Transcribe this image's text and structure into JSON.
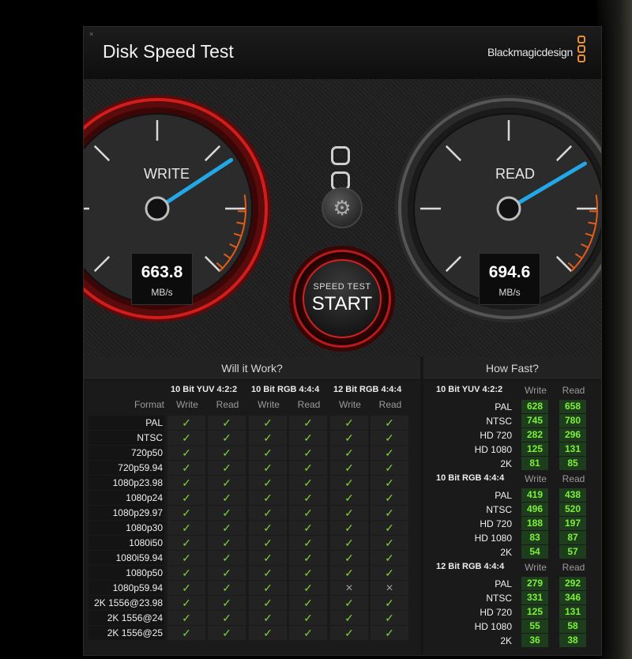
{
  "window": {
    "title": "Disk Speed Test",
    "brand": "Blackmagicdesign",
    "close_glyph": "×"
  },
  "gauges": {
    "write": {
      "label": "WRITE",
      "value": "663.8",
      "unit": "MB/s",
      "needle_fraction": 0.83,
      "accent": "#d21d1d"
    },
    "read": {
      "label": "READ",
      "value": "694.6",
      "unit": "MB/s",
      "needle_fraction": 0.87,
      "accent": "#555555"
    },
    "needle_color": "#22a8e8",
    "redline_color": "#e25c1a"
  },
  "start_button": {
    "small": "SPEED TEST",
    "big": "START"
  },
  "settings_icon": "gear-icon",
  "will_it_work": {
    "title": "Will it Work?",
    "format_header": "Format",
    "groups": [
      "10 Bit YUV 4:2:2",
      "10 Bit RGB 4:4:4",
      "12 Bit RGB 4:4:4"
    ],
    "sub_headers": [
      "Write",
      "Read",
      "Write",
      "Read",
      "Write",
      "Read"
    ],
    "check_glyph": "✓",
    "cross_glyph": "✕",
    "rows": [
      {
        "format": "PAL",
        "results": [
          1,
          1,
          1,
          1,
          1,
          1
        ]
      },
      {
        "format": "NTSC",
        "results": [
          1,
          1,
          1,
          1,
          1,
          1
        ]
      },
      {
        "format": "720p50",
        "results": [
          1,
          1,
          1,
          1,
          1,
          1
        ]
      },
      {
        "format": "720p59.94",
        "results": [
          1,
          1,
          1,
          1,
          1,
          1
        ]
      },
      {
        "format": "1080p23.98",
        "results": [
          1,
          1,
          1,
          1,
          1,
          1
        ]
      },
      {
        "format": "1080p24",
        "results": [
          1,
          1,
          1,
          1,
          1,
          1
        ]
      },
      {
        "format": "1080p29.97",
        "results": [
          1,
          1,
          1,
          1,
          1,
          1
        ]
      },
      {
        "format": "1080p30",
        "results": [
          1,
          1,
          1,
          1,
          1,
          1
        ]
      },
      {
        "format": "1080i50",
        "results": [
          1,
          1,
          1,
          1,
          1,
          1
        ]
      },
      {
        "format": "1080i59.94",
        "results": [
          1,
          1,
          1,
          1,
          1,
          1
        ]
      },
      {
        "format": "1080p50",
        "results": [
          1,
          1,
          1,
          1,
          1,
          1
        ]
      },
      {
        "format": "1080p59.94",
        "results": [
          1,
          1,
          1,
          1,
          0,
          0
        ]
      },
      {
        "format": "2K 1556@23.98",
        "results": [
          1,
          1,
          1,
          1,
          1,
          1
        ]
      },
      {
        "format": "2K 1556@24",
        "results": [
          1,
          1,
          1,
          1,
          1,
          1
        ]
      },
      {
        "format": "2K 1556@25",
        "results": [
          1,
          1,
          1,
          1,
          1,
          1
        ]
      }
    ]
  },
  "how_fast": {
    "title": "How Fast?",
    "write_header": "Write",
    "read_header": "Read",
    "groups": [
      {
        "name": "10 Bit YUV 4:2:2",
        "rows": [
          {
            "label": "PAL",
            "write": "628",
            "read": "658"
          },
          {
            "label": "NTSC",
            "write": "745",
            "read": "780"
          },
          {
            "label": "HD 720",
            "write": "282",
            "read": "296"
          },
          {
            "label": "HD 1080",
            "write": "125",
            "read": "131"
          },
          {
            "label": "2K",
            "write": "81",
            "read": "85"
          }
        ]
      },
      {
        "name": "10 Bit RGB 4:4:4",
        "rows": [
          {
            "label": "PAL",
            "write": "419",
            "read": "438"
          },
          {
            "label": "NTSC",
            "write": "496",
            "read": "520"
          },
          {
            "label": "HD 720",
            "write": "188",
            "read": "197"
          },
          {
            "label": "HD 1080",
            "write": "83",
            "read": "87"
          },
          {
            "label": "2K",
            "write": "54",
            "read": "57"
          }
        ]
      },
      {
        "name": "12 Bit RGB 4:4:4",
        "rows": [
          {
            "label": "PAL",
            "write": "279",
            "read": "292"
          },
          {
            "label": "NTSC",
            "write": "331",
            "read": "346"
          },
          {
            "label": "HD 720",
            "write": "125",
            "read": "131"
          },
          {
            "label": "HD 1080",
            "write": "55",
            "read": "58"
          },
          {
            "label": "2K",
            "write": "36",
            "read": "38"
          }
        ]
      }
    ]
  }
}
